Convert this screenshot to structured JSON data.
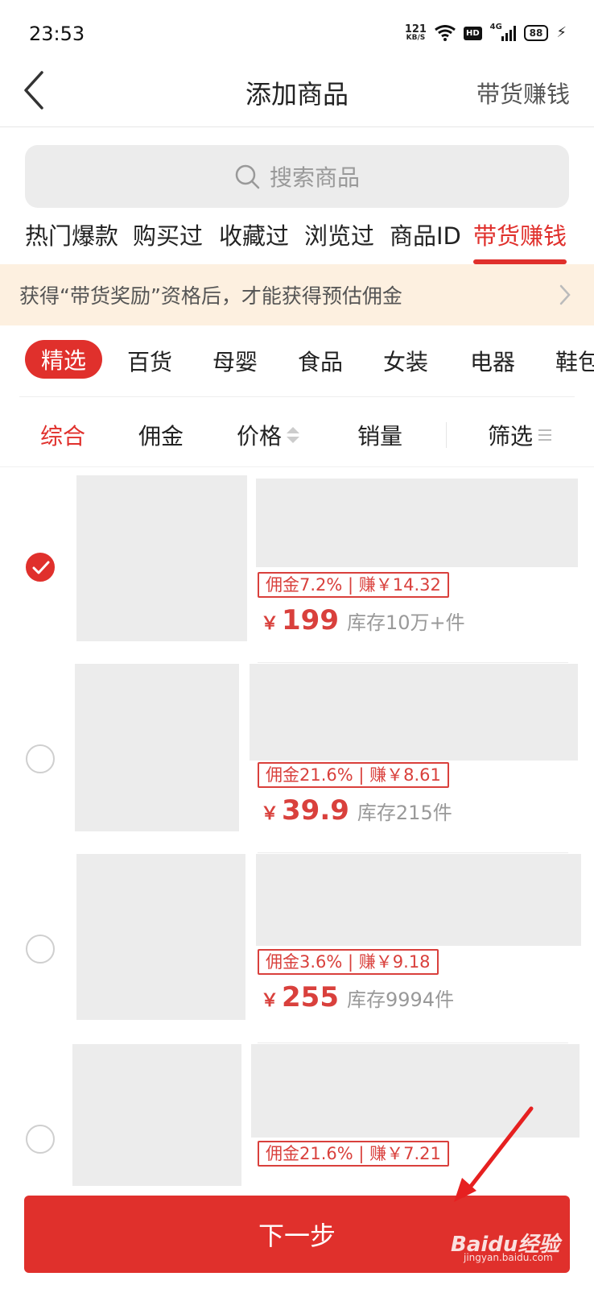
{
  "status_bar": {
    "time": "23:53",
    "net_speed": "121",
    "net_unit": "KB/S",
    "hd": "HD",
    "signal_label": "4G",
    "battery": "88"
  },
  "header": {
    "title": "添加商品",
    "action": "带货赚钱",
    "back_icon": "chevron-left-icon"
  },
  "search": {
    "placeholder": "搜索商品",
    "icon": "search-icon"
  },
  "source_tabs": [
    {
      "label": "热门爆款",
      "active": false
    },
    {
      "label": "购买过",
      "active": false
    },
    {
      "label": "收藏过",
      "active": false
    },
    {
      "label": "浏览过",
      "active": false
    },
    {
      "label": "商品ID",
      "active": false
    },
    {
      "label": "带货赚钱",
      "active": true
    }
  ],
  "notice": {
    "text": "获得“带货奖励”资格后，才能获得预估佣金"
  },
  "categories": [
    {
      "label": "精选",
      "active": true
    },
    {
      "label": "百货",
      "active": false
    },
    {
      "label": "母婴",
      "active": false
    },
    {
      "label": "食品",
      "active": false
    },
    {
      "label": "女装",
      "active": false
    },
    {
      "label": "电器",
      "active": false
    },
    {
      "label": "鞋包",
      "active": false
    }
  ],
  "sort": {
    "items": [
      "综合",
      "佣金",
      "价格",
      "销量"
    ],
    "active": "综合",
    "filter": "筛选"
  },
  "products": [
    {
      "selected": true,
      "commission": "佣金7.2% | 赚￥14.32",
      "currency": "￥",
      "price": "199",
      "stock": "库存10万+件"
    },
    {
      "selected": false,
      "commission": "佣金21.6% | 赚￥8.61",
      "currency": "￥",
      "price": "39.9",
      "stock": "库存215件"
    },
    {
      "selected": false,
      "commission": "佣金3.6% | 赚￥9.18",
      "currency": "￥",
      "price": "255",
      "stock": "库存9994件"
    },
    {
      "selected": false,
      "commission": "佣金21.6% | 赚￥7.21",
      "currency": "",
      "price": "",
      "stock": ""
    }
  ],
  "next_button": {
    "label": "下一步"
  },
  "watermark": {
    "brand": "Baidu经验",
    "url": "jingyan.baidu.com"
  },
  "colors": {
    "accent": "#e0302c",
    "notice_bg": "#fdf0e0",
    "placeholder_gray": "#ececec"
  }
}
